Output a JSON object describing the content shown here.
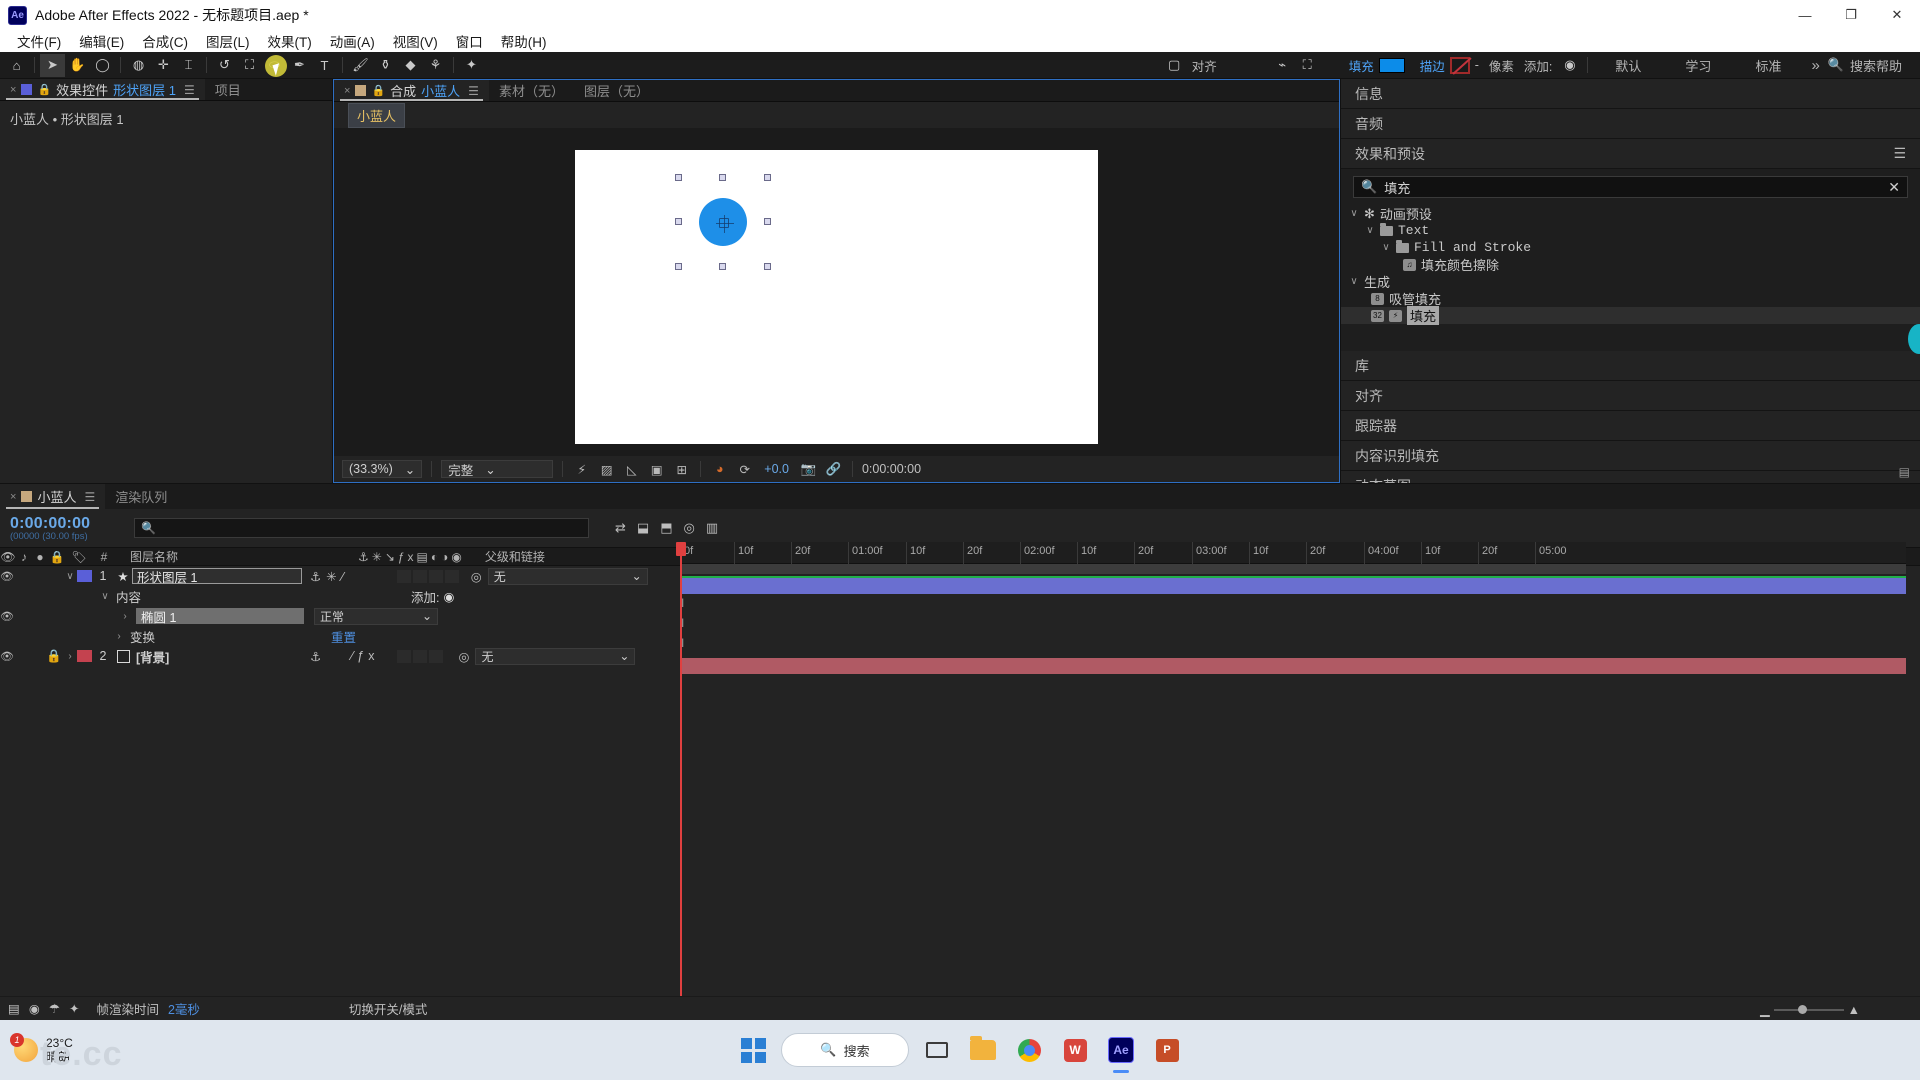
{
  "window": {
    "app_icon": "ae-logo-icon",
    "title": "Adobe After Effects 2022 - 无标题项目.aep *",
    "minimize": "—",
    "maximize": "❐",
    "close": "✕"
  },
  "menubar": {
    "items": [
      "文件(F)",
      "编辑(E)",
      "合成(C)",
      "图层(L)",
      "效果(T)",
      "动画(A)",
      "视图(V)",
      "窗口",
      "帮助(H)"
    ]
  },
  "toolbar": {
    "tools": [
      {
        "name": "home-icon",
        "glyph": "⌂"
      },
      {
        "name": "selection-tool",
        "glyph": "➤"
      },
      {
        "name": "hand-tool",
        "glyph": "✋"
      },
      {
        "name": "zoom-tool",
        "glyph": "🔍"
      },
      {
        "name": "orbit-tool",
        "glyph": "◍"
      },
      {
        "name": "pan-behind-tool",
        "glyph": "✛"
      },
      {
        "name": "camera-tool",
        "glyph": "⌶"
      },
      {
        "name": "rotation-tool",
        "glyph": "↺"
      },
      {
        "name": "roto-brush-tool",
        "glyph": "⛶"
      },
      {
        "name": "shape-tool",
        "glyph": "⬭"
      },
      {
        "name": "pen-tool",
        "glyph": "✒"
      },
      {
        "name": "type-tool",
        "glyph": "T"
      },
      {
        "name": "brush-tool",
        "glyph": "🖌"
      },
      {
        "name": "clone-stamp-tool",
        "glyph": "⚱"
      },
      {
        "name": "eraser-tool",
        "glyph": "◆"
      },
      {
        "name": "puppet-tool",
        "glyph": "⚘"
      },
      {
        "name": "star-tool",
        "glyph": "✦"
      }
    ],
    "align_label": "对齐",
    "fill_label": "填充",
    "fill_color": "#0c8ce9",
    "stroke_label": "描边",
    "stroke_color": "#c3343d",
    "pixels_label": "像素",
    "add_label": "添加:",
    "workspaces": [
      "默认",
      "学习",
      "标准"
    ],
    "chevron": "»",
    "search_help": "搜索帮助",
    "search_icon": "search-icon"
  },
  "left_panel": {
    "tabs": [
      {
        "label_prefix": "效果控件",
        "label_accent": "形状图层 1",
        "active": true
      },
      {
        "label_prefix": "项目",
        "label_accent": "",
        "active": false
      }
    ],
    "breadcrumb": "小蓝人 • 形状图层 1"
  },
  "comp_panel": {
    "tabs": [
      {
        "label_prefix": "合成",
        "label_accent": "小蓝人",
        "active": true
      },
      {
        "label_prefix": "素材（无）",
        "label_accent": "",
        "active": false
      },
      {
        "label_prefix": "图层（无）",
        "label_accent": "",
        "active": false
      }
    ],
    "comp_chip": "小蓝人",
    "bottom": {
      "zoom": "(33.3%)",
      "resolution": "完整",
      "exposure": "+0.0",
      "timecode": "0:00:00:00",
      "icons": [
        "fx-toggle-icon",
        "mask-toggle-icon",
        "grid-icon",
        "title-safe-icon",
        "snapshot-icon",
        "channel-icon",
        "refresh-icon",
        "camera-icon",
        "lock-icon"
      ]
    }
  },
  "right_panel": {
    "accordions": [
      "信息",
      "音频"
    ],
    "effects_title": "效果和预设",
    "menu_icon": "hamburger-icon",
    "search_value": "填充",
    "search_icon": "search-icon",
    "clear_icon": "clear-icon",
    "tree": [
      {
        "indent": 0,
        "twirl": "∨",
        "icon": "asterisk",
        "label": "动画预设"
      },
      {
        "indent": 1,
        "twirl": "∨",
        "icon": "folder",
        "label": "Text",
        "mono": true
      },
      {
        "indent": 2,
        "twirl": "∨",
        "icon": "folder",
        "label": "Fill and Stroke",
        "mono": true
      },
      {
        "indent": 3,
        "twirl": "",
        "icon": "preset",
        "label": "填充颜色擦除"
      },
      {
        "indent": 0,
        "twirl": "∨",
        "icon": "",
        "label": "生成"
      },
      {
        "indent": 1,
        "twirl": "",
        "icon": "badge8",
        "label": "吸管填充"
      },
      {
        "indent": 1,
        "twirl": "",
        "icon": "badge32",
        "label": "填充",
        "selected": true
      }
    ],
    "panels_below": [
      "库",
      "对齐",
      "跟踪器",
      "内容识别填充",
      "动态草图"
    ]
  },
  "timeline": {
    "tabs": [
      {
        "label": "小蓝人",
        "active": true
      },
      {
        "label": "渲染队列",
        "active": false
      }
    ],
    "current_time": "0:00:00:00",
    "fps_info": "(00000 (30.00 fps)",
    "search_placeholder": "",
    "search_icon": "search-icon",
    "columns": {
      "layer_name": "图层名称",
      "parent_link": "父级和链接"
    },
    "layers": [
      {
        "index": "1",
        "name": "形状图层 1",
        "label_color": "#5a5fd8",
        "editing": true,
        "star": "★",
        "parent": "无"
      },
      {
        "index": "2",
        "name": "[背景]",
        "label_color": "#c4424f",
        "editing": false,
        "star": "",
        "parent": "无",
        "locked": true
      }
    ],
    "properties": [
      {
        "level": 1,
        "twirl": "∨",
        "label": "内容",
        "right_label": "添加:",
        "right_type": "add"
      },
      {
        "level": 2,
        "twirl": "›",
        "label": "椭圆 1",
        "boxed": true,
        "mode": "正常"
      },
      {
        "level": 2,
        "twirl": "›",
        "label": "变换",
        "reset": "重置"
      }
    ],
    "ruler_ticks": [
      "0f",
      "10f",
      "20f",
      "01:00f",
      "10f",
      "20f",
      "02:00f",
      "10f",
      "20f",
      "03:00f",
      "10f",
      "20f",
      "04:00f",
      "10f",
      "20f",
      "05:00"
    ],
    "bottom": {
      "render_time_label": "帧渲染时间",
      "render_time_value": "2毫秒",
      "switches_label": "切换开关/模式"
    }
  },
  "taskbar": {
    "weather_temp": "23°C",
    "weather_desc": "晴朗",
    "weather_badge": "1",
    "search_label": "搜索",
    "search_icon": "search-icon",
    "items": [
      {
        "name": "windows-start-icon"
      },
      {
        "name": "task-view-icon"
      },
      {
        "name": "file-explorer-icon"
      },
      {
        "name": "chrome-icon"
      },
      {
        "name": "wps-icon"
      },
      {
        "name": "after-effects-icon",
        "active": true
      },
      {
        "name": "powerpoint-icon"
      }
    ],
    "watermark": "te.cc"
  }
}
